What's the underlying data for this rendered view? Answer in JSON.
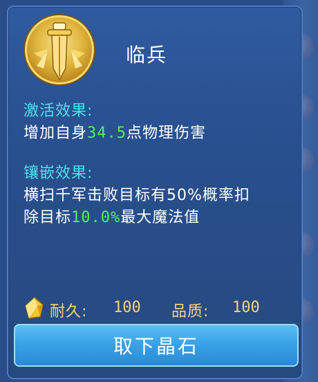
{
  "item": {
    "name": "临兵",
    "icon": "golden-sword-emblem-icon"
  },
  "activation": {
    "title": "激活效果:",
    "text_before": "增加自身",
    "value": "34.5",
    "text_after": "点物理伤害"
  },
  "inlay": {
    "title": "镶嵌效果:",
    "line1": "横扫千军击败目标有50%概率扣",
    "line2_before": "除目标",
    "line2_value": "10.0%",
    "line2_after": "最大魔法值"
  },
  "stats": {
    "icon": "yellow-crystal-icon",
    "durability_label": "耐久:",
    "durability_value": "100",
    "quality_label": "品质:",
    "quality_value": "100"
  },
  "actions": {
    "remove_label": "取下晶石"
  },
  "colors": {
    "panel": "#2a4d8a",
    "section_title": "#4fe0ea",
    "highlight_value": "#4ff064",
    "stat_text": "#ffd27a",
    "button": "#3aa2e6"
  }
}
